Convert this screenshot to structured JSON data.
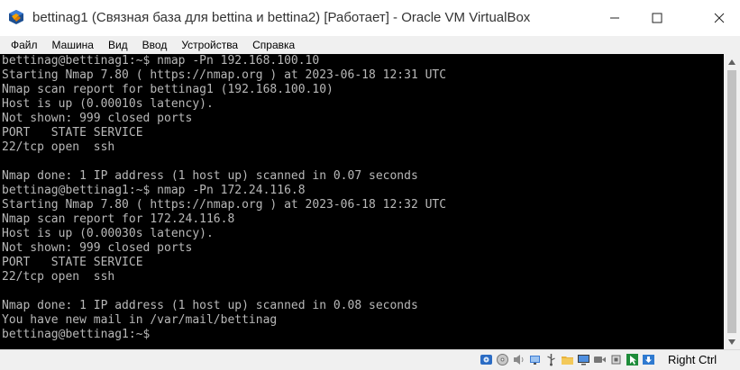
{
  "window": {
    "title": "bettinag1 (Связная база для bettina и bettina2) [Работает] - Oracle VM VirtualBox"
  },
  "menu": [
    "Файл",
    "Машина",
    "Вид",
    "Ввод",
    "Устройства",
    "Справка"
  ],
  "terminal": {
    "lines": [
      "bettinag@bettinag1:~$ nmap -Pn 192.168.100.10",
      "Starting Nmap 7.80 ( https://nmap.org ) at 2023-06-18 12:31 UTC",
      "Nmap scan report for bettinag1 (192.168.100.10)",
      "Host is up (0.00010s latency).",
      "Not shown: 999 closed ports",
      "PORT   STATE SERVICE",
      "22/tcp open  ssh",
      "",
      "Nmap done: 1 IP address (1 host up) scanned in 0.07 seconds",
      "bettinag@bettinag1:~$ nmap -Pn 172.24.116.8",
      "Starting Nmap 7.80 ( https://nmap.org ) at 2023-06-18 12:32 UTC",
      "Nmap scan report for 172.24.116.8",
      "Host is up (0.00030s latency).",
      "Not shown: 999 closed ports",
      "PORT   STATE SERVICE",
      "22/tcp open  ssh",
      "",
      "Nmap done: 1 IP address (1 host up) scanned in 0.08 seconds",
      "You have new mail in /var/mail/bettinag",
      "bettinag@bettinag1:~$"
    ]
  },
  "statusbar": {
    "host_key": "Right Ctrl",
    "icons": [
      "hard-disk-icon",
      "optical-drive-icon",
      "audio-icon",
      "network-icon",
      "usb-icon",
      "shared-folders-icon",
      "display-icon",
      "video-capture-icon",
      "cpu-icon",
      "mouse-integration-icon",
      "keyboard-icon"
    ]
  },
  "colors": {
    "terminal_bg": "#000000",
    "terminal_fg": "#b8b8b8",
    "chrome_bg": "#f0f0f0"
  }
}
